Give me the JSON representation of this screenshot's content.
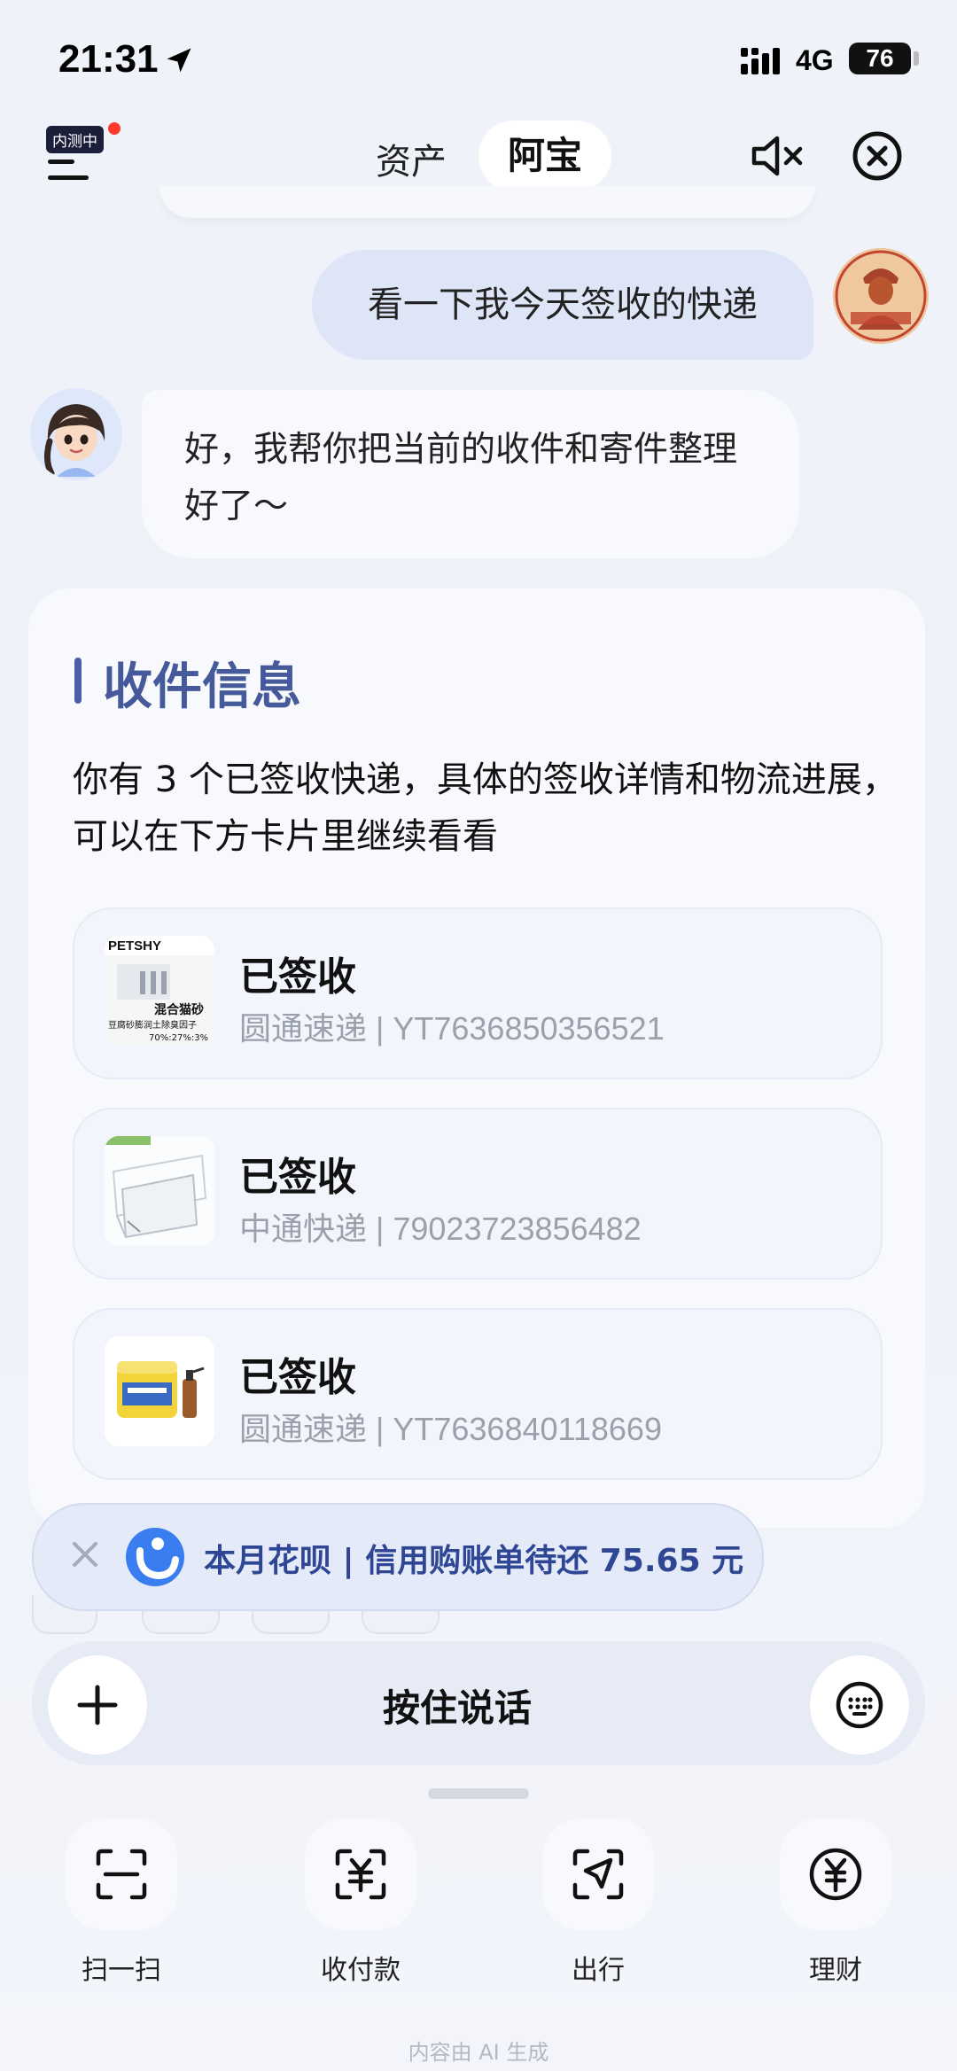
{
  "status_bar": {
    "time": "21:31",
    "network": "4G",
    "battery": "76"
  },
  "nav": {
    "beta_badge": "内测中",
    "tab_assets": "资产",
    "tab_abao": "阿宝"
  },
  "chat": {
    "user_message": "看一下我今天签收的快递",
    "ai_message": "好，我帮你把当前的收件和寄件整理好了～"
  },
  "card": {
    "title": "收件信息",
    "description": "你有 3 个已签收快递，具体的签收详情和物流进展，可以在下方卡片里继续看看",
    "parcels": [
      {
        "status": "已签收",
        "detail": "圆通速递 | YT7636850356521",
        "thumb_brand": "PETSHY",
        "thumb_caption": "混合猫砂",
        "thumb_sub": "豆腐砂膨润土除臭因子",
        "thumb_ratio": "70%:27%:3%"
      },
      {
        "status": "已签收",
        "detail": "中通快递 | 79023723856482"
      },
      {
        "status": "已签收",
        "detail": "圆通速递 | YT7636840118669"
      }
    ]
  },
  "huabei": {
    "text": "本月花呗 | 信用购账单待还 75.65 元"
  },
  "input": {
    "hold_to_talk": "按住说话"
  },
  "shortcuts": [
    {
      "label": "扫一扫",
      "icon": "scan-icon"
    },
    {
      "label": "收付款",
      "icon": "payment-icon"
    },
    {
      "label": "出行",
      "icon": "travel-icon"
    },
    {
      "label": "理财",
      "icon": "wealth-icon"
    }
  ],
  "footer_note": "内容由 AI 生成",
  "colors": {
    "accent": "#465a9b",
    "user_bubble": "#dde5f6",
    "huabei_blue": "#2f4694",
    "huabei_logo": "#3a7df0"
  }
}
